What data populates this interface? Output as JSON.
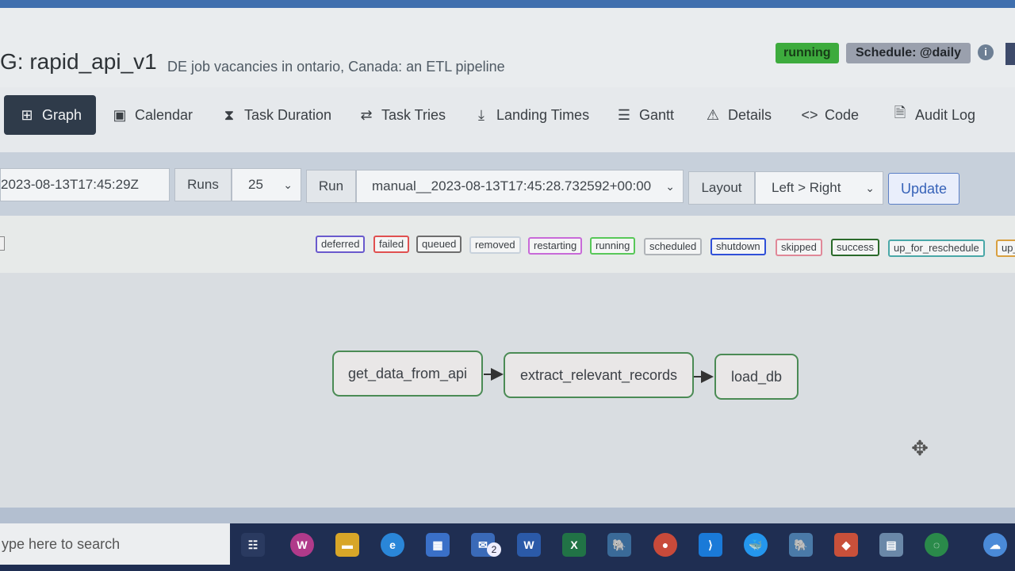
{
  "header": {
    "title": "G: rapid_api_v1",
    "description": "DE job vacancies in ontario, Canada: an ETL pipeline",
    "state": "running",
    "schedule": "Schedule: @daily",
    "info": "i"
  },
  "nav": {
    "tabs": [
      {
        "label": "Graph",
        "icon": "graph-icon",
        "glyph": "⊞",
        "active": true
      },
      {
        "label": "Calendar",
        "icon": "calendar-icon",
        "glyph": "▣"
      },
      {
        "label": "Task Duration",
        "icon": "hourglass-icon",
        "glyph": "⧗"
      },
      {
        "label": "Task Tries",
        "icon": "retry-icon",
        "glyph": "⇄"
      },
      {
        "label": "Landing Times",
        "icon": "plane-landing-icon",
        "glyph": "⤓"
      },
      {
        "label": "Gantt",
        "icon": "gantt-icon",
        "glyph": "☰"
      },
      {
        "label": "Details",
        "icon": "warning-icon",
        "glyph": "⚠"
      },
      {
        "label": "Code",
        "icon": "code-icon",
        "glyph": "<>"
      },
      {
        "label": "Audit Log",
        "icon": "audit-log-icon",
        "glyph": "🗎"
      }
    ]
  },
  "controls": {
    "base_date": "2023-08-13T17:45:29Z",
    "runs_label": "Runs",
    "runs_value": "25",
    "run_label": "Run",
    "run_value": "manual__2023-08-13T17:45:28.732592+00:00",
    "layout_label": "Layout",
    "layout_value": "Left > Right",
    "update_label": "Update"
  },
  "legend": [
    {
      "label": "deferred",
      "color": "#6a5acd"
    },
    {
      "label": "failed",
      "color": "#e05050"
    },
    {
      "label": "queued",
      "color": "#6e6e6e"
    },
    {
      "label": "removed",
      "color": "#c8d2dc"
    },
    {
      "label": "restarting",
      "color": "#c86ad8"
    },
    {
      "label": "running",
      "color": "#58c858"
    },
    {
      "label": "scheduled",
      "color": "#b0b4b8"
    },
    {
      "label": "shutdown",
      "color": "#3050d8"
    },
    {
      "label": "skipped",
      "color": "#e08898"
    },
    {
      "label": "success",
      "color": "#2a6a2a"
    },
    {
      "label": "up_for_reschedule",
      "color": "#4aa8a8"
    },
    {
      "label": "up_",
      "color": "#d8a040"
    }
  ],
  "graph": {
    "nodes": [
      {
        "id": "get_data_from_api",
        "label": "get_data_from_api"
      },
      {
        "id": "extract_relevant_records",
        "label": "extract_relevant_records"
      },
      {
        "id": "load_db",
        "label": "load_db"
      }
    ]
  },
  "taskbar": {
    "search_placeholder": "ype here to search",
    "mail_badge": "2",
    "icons": [
      {
        "name": "task-view-icon",
        "glyph": "☷",
        "color": "#2a3a60"
      },
      {
        "name": "wps-icon",
        "glyph": "W",
        "color": "#b03a8a"
      },
      {
        "name": "file-explorer-icon",
        "glyph": "▬",
        "color": "#d8a628"
      },
      {
        "name": "edge-browser-icon",
        "glyph": "e",
        "color": "#2a86d8"
      },
      {
        "name": "store-icon",
        "glyph": "▦",
        "color": "#3a70c8"
      },
      {
        "name": "mail-icon",
        "glyph": "✉",
        "color": "#3a6ab8"
      },
      {
        "name": "word-icon",
        "glyph": "W",
        "color": "#2b5aa8"
      },
      {
        "name": "excel-icon",
        "glyph": "X",
        "color": "#217346"
      },
      {
        "name": "postgres-icon",
        "glyph": "🐘",
        "color": "#3a6a98"
      },
      {
        "name": "chrome-icon",
        "glyph": "●",
        "color": "#c84a3a"
      },
      {
        "name": "vscode-icon",
        "glyph": "⟩",
        "color": "#1a7ad8"
      },
      {
        "name": "docker-icon",
        "glyph": "🐳",
        "color": "#2496ed"
      },
      {
        "name": "pgadmin-icon",
        "glyph": "🐘",
        "color": "#4a7aa8"
      },
      {
        "name": "git-icon",
        "glyph": "◆",
        "color": "#c8503a"
      },
      {
        "name": "notepad-icon",
        "glyph": "▤",
        "color": "#6a88a8"
      },
      {
        "name": "loading-ring-icon",
        "glyph": "◌",
        "color": "#2a8a4a"
      },
      {
        "name": "cloud-icon",
        "glyph": "☁",
        "color": "#4a8ad8"
      }
    ]
  }
}
